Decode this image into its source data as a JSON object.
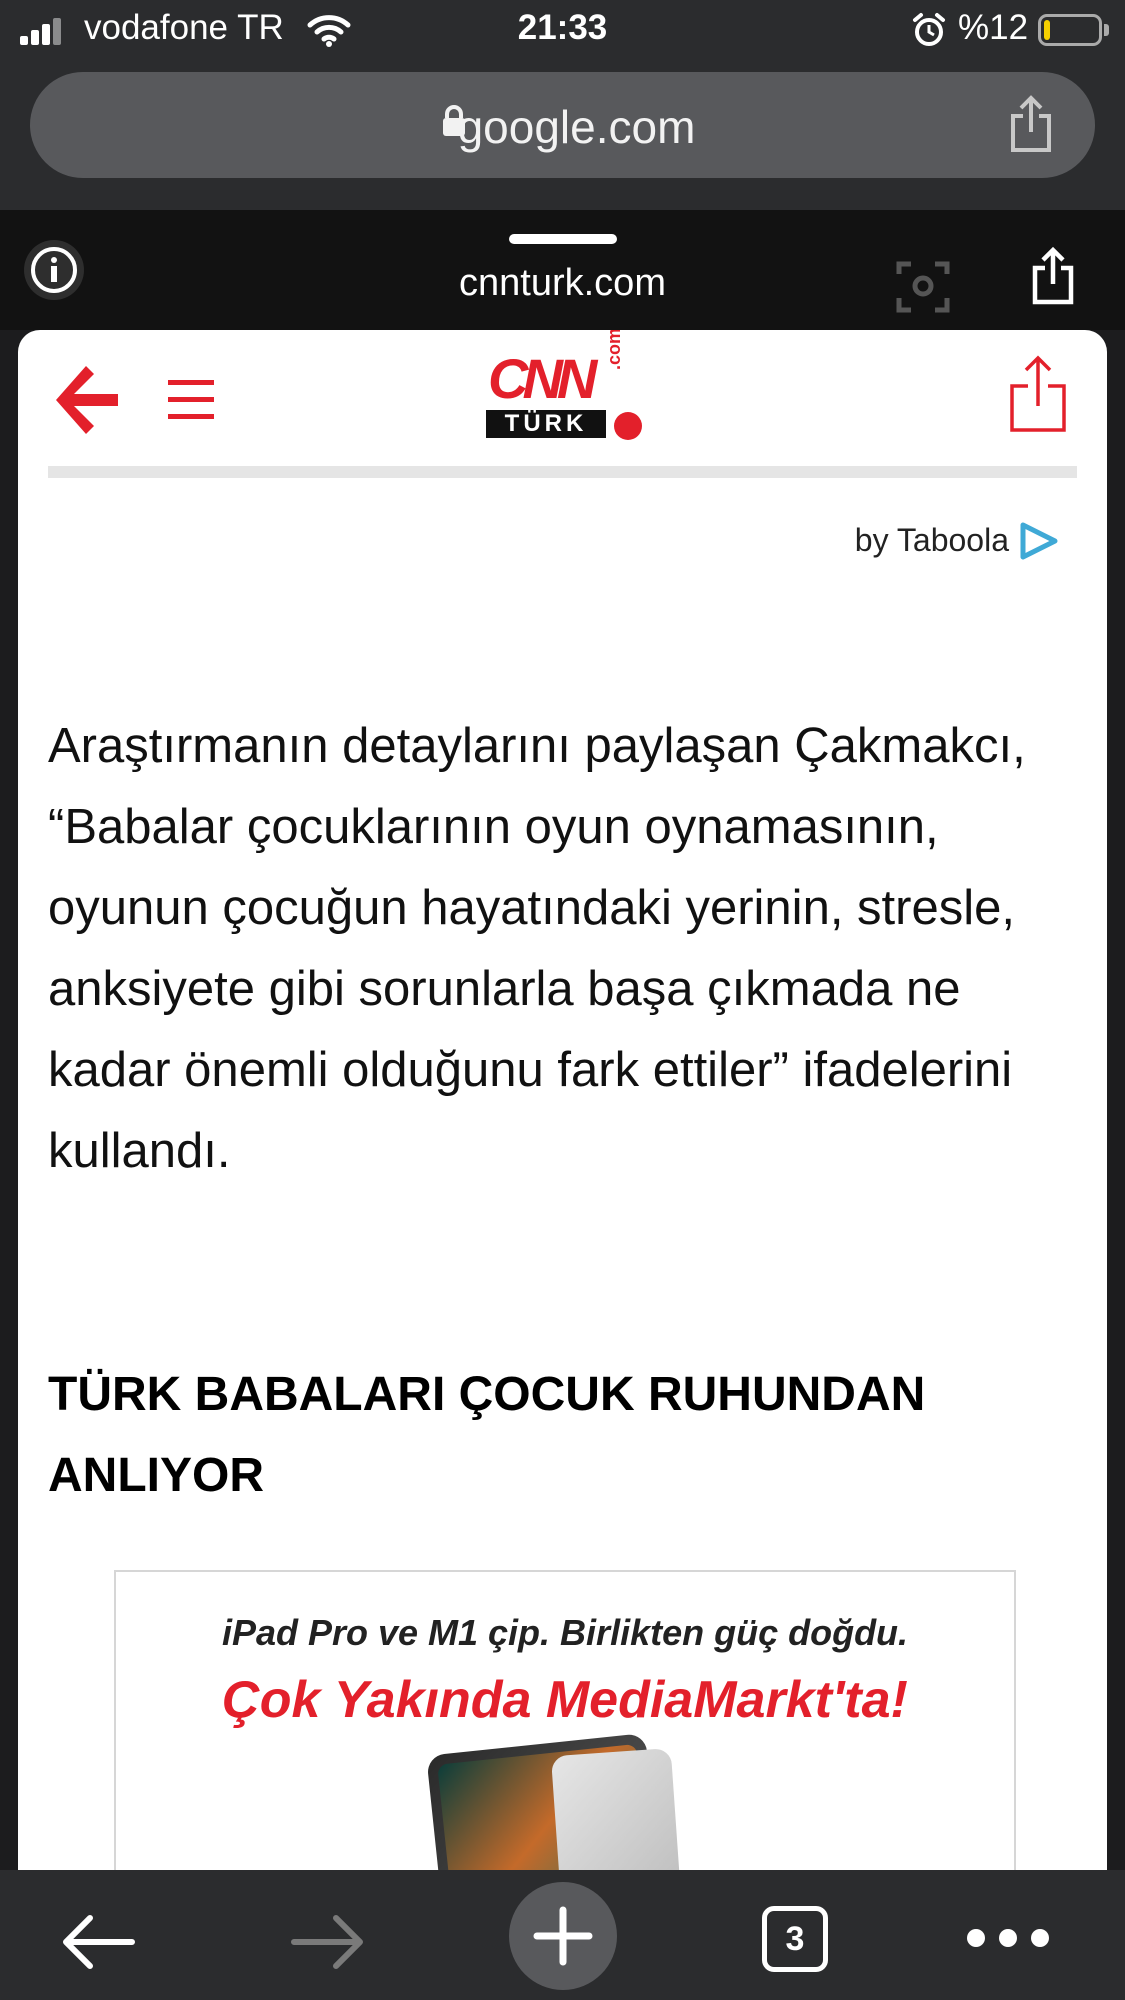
{
  "status_bar": {
    "carrier": "vodafone TR",
    "time": "21:33",
    "battery": "%12",
    "battery_level": 0.12
  },
  "browser": {
    "url": "google.com",
    "amp_domain": "cnnturk.com",
    "open_tabs": "3"
  },
  "site": {
    "logo_text_main": "CNN",
    "logo_text_sub": "TÜRK",
    "logo_text_com": ".com"
  },
  "article": {
    "taboola": "by Taboola",
    "paragraph": "Araştırmanın detaylarını paylaşan Çakmakcı, “Babalar çocuklarının oyun oynamasının, oyunun çocuğun hayatındaki yerinin, stresle, anksiyete gibi sorunlarla başa çıkmada ne kadar önemli olduğunu fark ettiler” ifadelerini kullandı.",
    "heading": "TÜRK BABALARI ÇOCUK RUHUNDAN ANLIYOR"
  },
  "ad": {
    "line1": "iPad Pro ve M1 çip. Birlikten güç doğdu.",
    "line2": "Çok Yakında MediaMarkt'ta!"
  },
  "colors": {
    "brand_red": "#e3202b",
    "taboola_blue": "#3fa9d6",
    "chrome_bg": "#2b2c2e"
  }
}
